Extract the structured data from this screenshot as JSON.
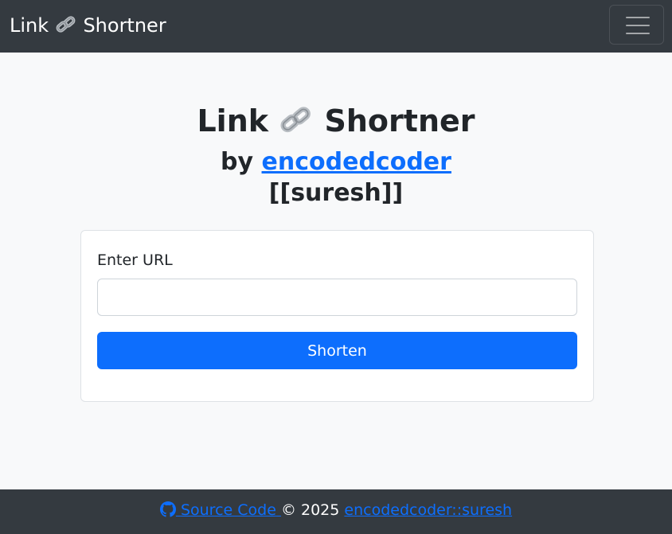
{
  "navbar": {
    "brand_prefix": "Link",
    "brand_icon": "link-icon",
    "brand_suffix": "Shortner",
    "toggler_icon": "hamburger-menu-icon"
  },
  "hero": {
    "title_prefix": "Link",
    "title_icon": "link-icon",
    "title_suffix": "Shortner",
    "by_text": "by ",
    "author_link": "encodedcoder",
    "username": "[[suresh]]"
  },
  "form": {
    "label": "Enter URL",
    "input_value": "",
    "input_placeholder": "",
    "button_label": "Shorten"
  },
  "footer": {
    "github_icon": "github-icon",
    "source_link": "Source Code",
    "copyright": "© 2025",
    "author_link": "encodedcoder::suresh"
  },
  "colors": {
    "navbar_bg": "#343a40",
    "page_bg": "#f8f9fa",
    "primary": "#0d6efd",
    "text": "#212529"
  }
}
